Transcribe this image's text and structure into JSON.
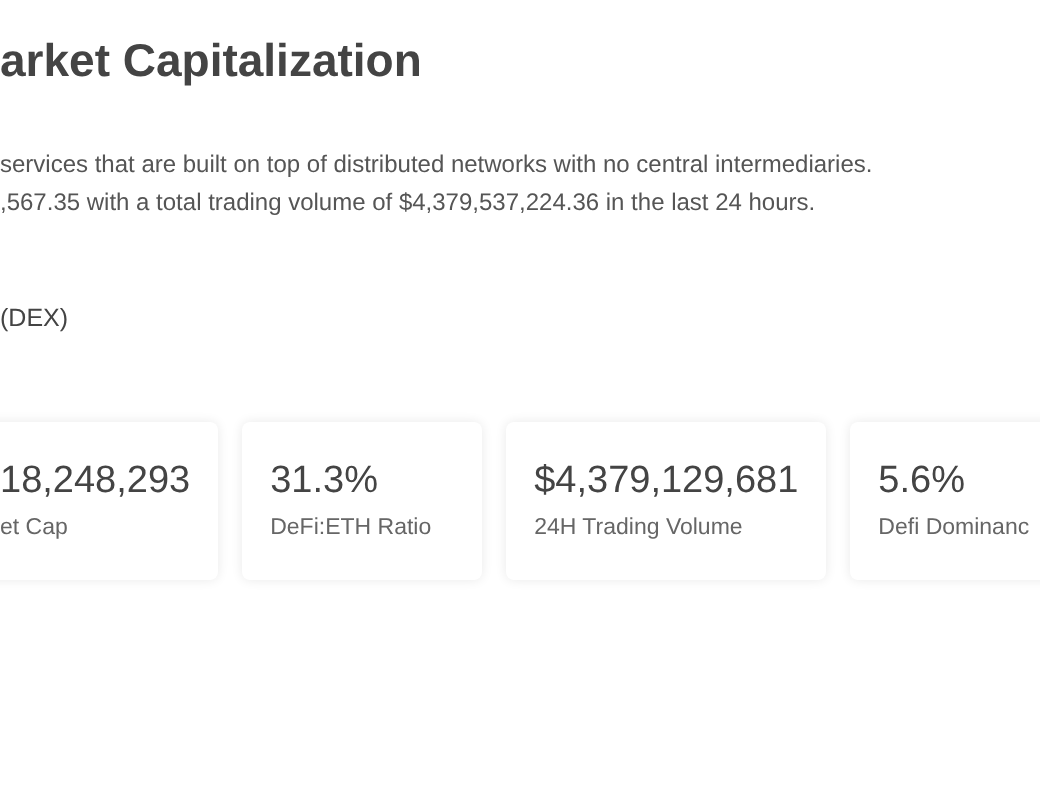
{
  "title": "arket Capitalization",
  "description": [
    "services that are built on top of distributed networks with no central intermediaries.",
    ",567.35 with a total trading volume of $4,379,537,224.36 in the last 24 hours."
  ],
  "note": "(DEX)",
  "stats": [
    {
      "value": "18,248,293",
      "label": "et Cap"
    },
    {
      "value": "31.3%",
      "label": "DeFi:ETH Ratio"
    },
    {
      "value": "$4,379,129,681",
      "label": "24H Trading Volume"
    },
    {
      "value": "5.6%",
      "label": "Defi Dominanc"
    }
  ]
}
